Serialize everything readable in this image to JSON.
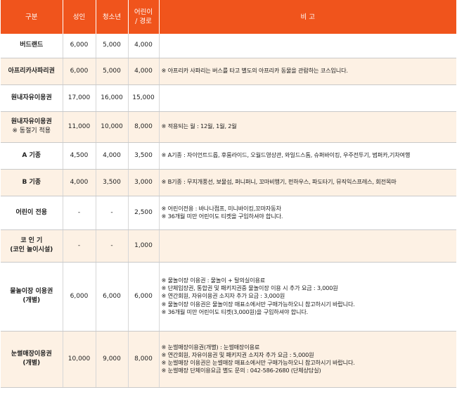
{
  "header": {
    "category": "구분",
    "adult": "성인",
    "youth": "청소년",
    "child_line1": "어린이",
    "child_line2": "/ 경로",
    "note": "비 고"
  },
  "rows": [
    {
      "name": "버드랜드",
      "adult": "6,000",
      "youth": "5,000",
      "child": "4,000",
      "notes": []
    },
    {
      "name": "아프리카사파리권",
      "adult": "6,000",
      "youth": "5,000",
      "child": "4,000",
      "notes": [
        "※ 아프리카 사파리는 버스를 타고 별도의 아프리카 동물을 관람하는 코스입니다."
      ]
    },
    {
      "name": "원내자유이용권",
      "adult": "17,000",
      "youth": "16,000",
      "child": "15,000",
      "notes": []
    },
    {
      "name": "원내자유이용권",
      "name_sub": "※ 동절기 적용",
      "adult": "11,000",
      "youth": "10,000",
      "child": "8,000",
      "notes": [
        "※ 적용되는 월 : 12월, 1월, 2월"
      ]
    },
    {
      "name": "A 기종",
      "adult": "4,500",
      "youth": "4,000",
      "child": "3,500",
      "notes": [
        "※ A기종 : 자이언트드롭, 후룸라이드, 오월드영상관, 와일드스톰, 슈퍼바이킹, 우주전투기, 범퍼카,기차여행"
      ]
    },
    {
      "name": "B 기종",
      "adult": "4,000",
      "youth": "3,500",
      "child": "3,000",
      "notes": [
        "※ B기종 : 무지개풍선, 보물섬, 퍼니퍼니, 꼬마비행기, 펀하우스, 파도타기, 뮤직익스프레스, 회전목마"
      ]
    },
    {
      "name": "어린이 전용",
      "adult": "-",
      "youth": "-",
      "child": "2,500",
      "notes": [
        "※ 어린이전용 : 바나나점프, 미니바이킹,꼬마자동차",
        "※ 36개월 미만 어린이도 티켓을 구입하셔야 합니다."
      ]
    },
    {
      "name": "코 인 기",
      "name_sub": "(코인 놀이시설)",
      "adult": "-",
      "youth": "-",
      "child": "1,000",
      "notes": []
    },
    {
      "name": "물놀이장 이용권",
      "name_sub": "(개별)",
      "adult": "6,000",
      "youth": "6,000",
      "child": "6,000",
      "notes": [
        "※ 물놀이장 이용권 : 물놀이 + 탈의실이용료",
        "※ 단체입장권, 통합권 및 패키지권중 물놀이장 이용 시 추가 요금 : 3,000원",
        "※ 연간회원, 자유이용권 소지자 추가 요금 : 3,000원",
        "※ 물놀이장 이용권은 물놀이장 매표소에서만 구매가능하오니 참고하시기 바랍니다.",
        "※ 36개월 미만 어린이도 티켓(3,000원)을 구입하셔야 합니다."
      ]
    },
    {
      "name": "눈썰매장이용권",
      "name_sub": "(개별)",
      "adult": "10,000",
      "youth": "9,000",
      "child": "8,000",
      "notes": [
        "※ 눈썰매장이용권(개별) : 눈썰매장이용료",
        "※ 연간회원, 자유이용권 및 패키지권 소지자 추가 요금 : 5,000원",
        "※ 눈썰매장 이용권은 눈썰매장 매표소에서만 구매가능하오니 참고하시기 바랍니다.",
        "※ 눈썰매장 단체이용요금 별도 문의 : 042-586-2680 (단체상담실)"
      ]
    }
  ]
}
